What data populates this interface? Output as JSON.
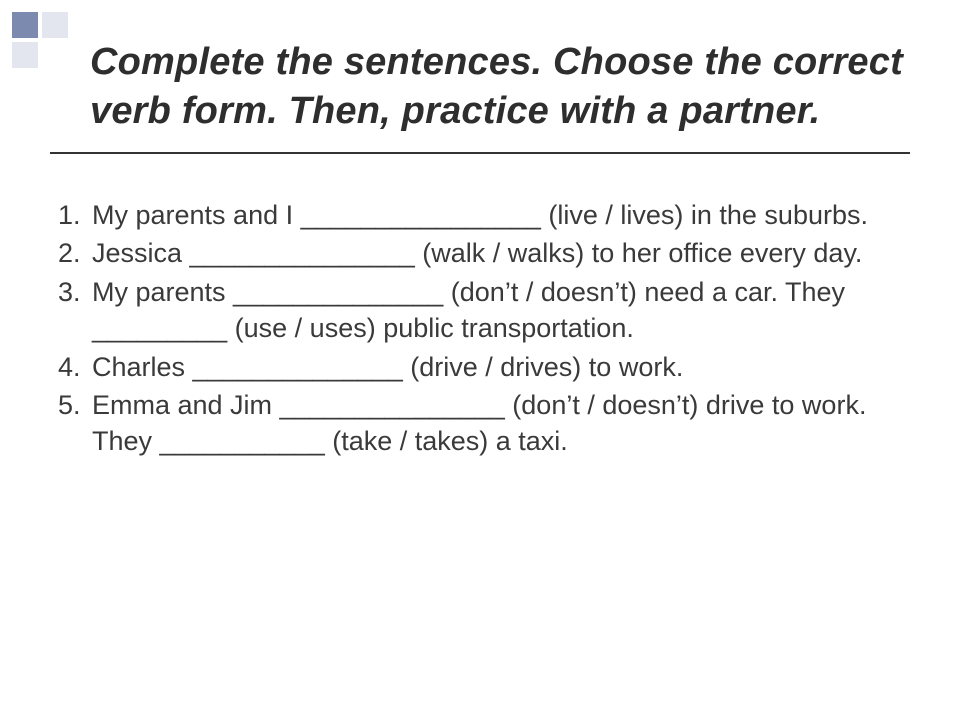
{
  "title": "Complete the sentences. Choose the correct verb form. Then, practice with a partner.",
  "items": [
    {
      "num": "1.",
      "text": "My parents and I ________________ (live / lives) in the suburbs."
    },
    {
      "num": "2.",
      "text": "Jessica _______________ (walk / walks) to her office every day."
    },
    {
      "num": "3.",
      "text": "My parents ______________ (don’t / doesn’t) need a car. They _________ (use / uses) public transportation."
    },
    {
      "num": "4.",
      "text": "Charles ______________ (drive / drives) to work."
    },
    {
      "num": "5.",
      "text": "Emma and Jim _______________ (don’t / doesn’t) drive to work. They ___________ (take / takes) a taxi."
    }
  ]
}
